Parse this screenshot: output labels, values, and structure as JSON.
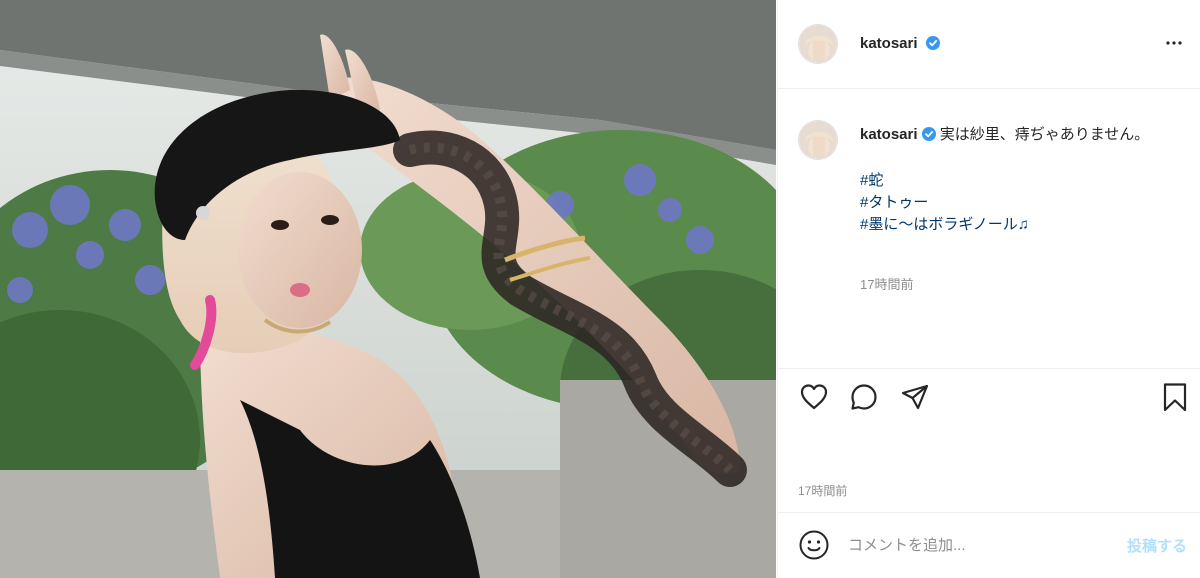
{
  "post": {
    "image_alt": "Woman in black beret showing snake tattoo on arm",
    "author": {
      "username": "katosari",
      "verified": true
    },
    "caption": {
      "text": "実は紗里、痔ぢゃありません。",
      "hashtags": [
        "#蛇",
        "#タトゥー",
        "#墨に〜はボラギノール♫"
      ],
      "timestamp": "17時間前"
    },
    "timestamp": "17時間前"
  },
  "actions": {
    "like_icon": "heart-icon",
    "comment_icon": "comment-icon",
    "share_icon": "paper-plane-icon",
    "save_icon": "bookmark-icon",
    "more_icon": "ellipsis-icon"
  },
  "comment": {
    "emoji_icon": "smiley-icon",
    "placeholder": "コメントを追加...",
    "post_label": "投稿する"
  },
  "colors": {
    "verified": "#3897f0",
    "hashtag": "#00376b",
    "muted": "#8e8e8e",
    "post_button_disabled": "#b2dffc",
    "divider": "#efefef"
  }
}
